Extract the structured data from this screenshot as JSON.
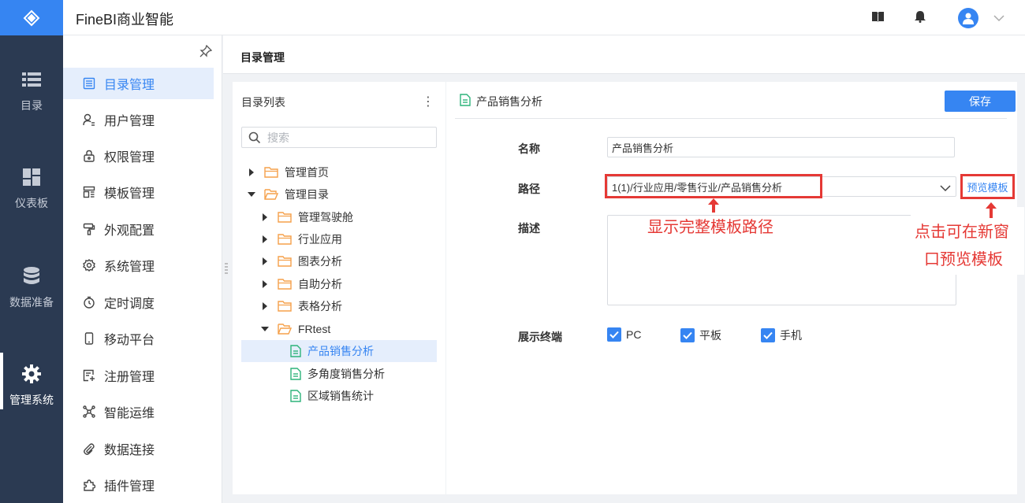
{
  "app": {
    "title": "FineBI商业智能"
  },
  "rail": {
    "items": [
      {
        "label": "目录",
        "icon": "list-icon"
      },
      {
        "label": "仪表板",
        "icon": "dashboard-icon"
      },
      {
        "label": "数据准备",
        "icon": "database-icon"
      },
      {
        "label": "管理系统",
        "icon": "gear-icon",
        "active": true
      }
    ]
  },
  "subnav": {
    "items": [
      {
        "label": "目录管理",
        "icon": "catalog-icon",
        "active": true
      },
      {
        "label": "用户管理",
        "icon": "user-icon"
      },
      {
        "label": "权限管理",
        "icon": "lock-icon"
      },
      {
        "label": "模板管理",
        "icon": "template-icon"
      },
      {
        "label": "外观配置",
        "icon": "brush-icon"
      },
      {
        "label": "系统管理",
        "icon": "settings-icon"
      },
      {
        "label": "定时调度",
        "icon": "timer-icon"
      },
      {
        "label": "移动平台",
        "icon": "mobile-icon"
      },
      {
        "label": "注册管理",
        "icon": "register-icon"
      },
      {
        "label": "智能运维",
        "icon": "ops-icon"
      },
      {
        "label": "数据连接",
        "icon": "link-icon"
      },
      {
        "label": "插件管理",
        "icon": "plugin-icon"
      }
    ]
  },
  "page": {
    "title": "目录管理"
  },
  "directory": {
    "header": "目录列表",
    "more": "⋮",
    "search_placeholder": "搜索",
    "tree": [
      {
        "label": "管理首页",
        "type": "folder",
        "level": 0,
        "state": "collapsed"
      },
      {
        "label": "管理目录",
        "type": "folder",
        "level": 0,
        "state": "expanded"
      },
      {
        "label": "管理驾驶舱",
        "type": "folder",
        "level": 1,
        "state": "collapsed"
      },
      {
        "label": "行业应用",
        "type": "folder",
        "level": 1,
        "state": "collapsed"
      },
      {
        "label": "图表分析",
        "type": "folder",
        "level": 1,
        "state": "collapsed"
      },
      {
        "label": "自助分析",
        "type": "folder",
        "level": 1,
        "state": "collapsed"
      },
      {
        "label": "表格分析",
        "type": "folder",
        "level": 1,
        "state": "collapsed"
      },
      {
        "label": "FRtest",
        "type": "folder",
        "level": 1,
        "state": "expanded"
      },
      {
        "label": "产品销售分析",
        "type": "file",
        "level": 2,
        "selected": true
      },
      {
        "label": "多角度销售分析",
        "type": "file",
        "level": 2
      },
      {
        "label": "区域销售统计",
        "type": "file",
        "level": 2
      }
    ]
  },
  "editor": {
    "header_name": "产品销售分析",
    "save_label": "保存",
    "name_label": "名称",
    "name_value": "产品销售分析",
    "path_label": "路径",
    "path_value": "1(1)/行业应用/零售行业/产品销售分析",
    "preview_label": "预览模板",
    "desc_label": "描述",
    "terminal_label": "展示终端",
    "terminals": [
      {
        "label": "PC",
        "checked": true
      },
      {
        "label": "平板",
        "checked": true
      },
      {
        "label": "手机",
        "checked": true
      }
    ]
  },
  "annotations": {
    "path_note": "显示完整模板路径",
    "preview_note_line1": "点击可在新窗",
    "preview_note_line2": "口预览模板"
  },
  "colors": {
    "accent": "#3685f2",
    "rail_bg": "#2b3a52",
    "annotation": "#e53935",
    "folder": "#f5a04a",
    "file": "#2db37a"
  }
}
